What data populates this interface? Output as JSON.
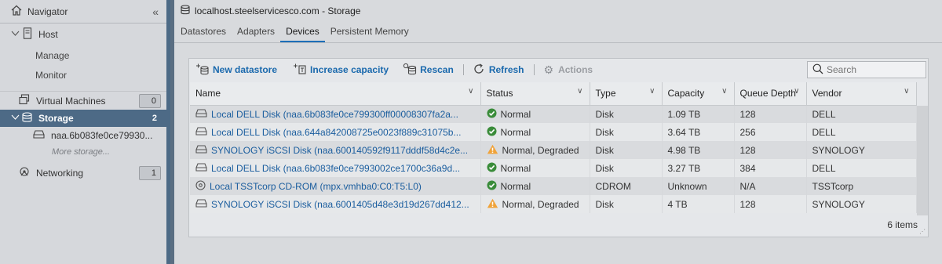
{
  "navigator": {
    "title": "Navigator",
    "host": {
      "label": "Host",
      "sub": [
        "Manage",
        "Monitor"
      ]
    },
    "virtual_machines": {
      "label": "Virtual Machines",
      "count": "0"
    },
    "storage": {
      "label": "Storage",
      "count": "2",
      "child": "naa.6b083fe0ce79930...",
      "more": "More storage..."
    },
    "networking": {
      "label": "Networking",
      "count": "1"
    }
  },
  "window": {
    "title": "localhost.steelservicesco.com - Storage"
  },
  "tabs": [
    "Datastores",
    "Adapters",
    "Devices",
    "Persistent Memory"
  ],
  "active_tab": "Devices",
  "toolbar": {
    "new_datastore": "New datastore",
    "increase_capacity": "Increase capacity",
    "rescan": "Rescan",
    "refresh": "Refresh",
    "actions": "Actions",
    "search_placeholder": "Search"
  },
  "table": {
    "columns": [
      "Name",
      "Status",
      "Type",
      "Capacity",
      "Queue Depth",
      "Vendor"
    ],
    "rows": [
      {
        "name": "Local DELL Disk (naa.6b083fe0ce799300ff00008307fa2a...",
        "status": "Normal",
        "status_kind": "ok",
        "type": "Disk",
        "capacity": "1.09 TB",
        "queue": "128",
        "vendor": "DELL",
        "icon": "disk-icon"
      },
      {
        "name": "Local DELL Disk (naa.644a842008725e0023f889c31075b...",
        "status": "Normal",
        "status_kind": "ok",
        "type": "Disk",
        "capacity": "3.64 TB",
        "queue": "256",
        "vendor": "DELL",
        "icon": "disk-icon"
      },
      {
        "name": "SYNOLOGY iSCSI Disk (naa.600140592f9117dddf58d4c2e...",
        "status": "Normal, Degraded",
        "status_kind": "warn",
        "type": "Disk",
        "capacity": "4.98 TB",
        "queue": "128",
        "vendor": "SYNOLOGY",
        "icon": "disk-icon"
      },
      {
        "name": "Local DELL Disk (naa.6b083fe0ce7993002ce1700c36a9d...",
        "status": "Normal",
        "status_kind": "ok",
        "type": "Disk",
        "capacity": "3.27 TB",
        "queue": "384",
        "vendor": "DELL",
        "icon": "disk-icon"
      },
      {
        "name": "Local TSSTcorp CD-ROM (mpx.vmhba0:C0:T5:L0)",
        "status": "Normal",
        "status_kind": "ok",
        "type": "CDROM",
        "capacity": "Unknown",
        "queue": "N/A",
        "vendor": "TSSTcorp",
        "icon": "cdrom-icon"
      },
      {
        "name": "SYNOLOGY iSCSI Disk (naa.6001405d48e3d19d267dd412...",
        "status": "Normal, Degraded",
        "status_kind": "warn",
        "type": "Disk",
        "capacity": "4 TB",
        "queue": "128",
        "vendor": "SYNOLOGY",
        "icon": "disk-icon"
      }
    ],
    "item_count": "6 items"
  },
  "colors": {
    "accent": "#1a69ad",
    "sidebar_selected": "#4d6a86",
    "ok": "#3a8c3a",
    "warn": "#f0a33a"
  }
}
